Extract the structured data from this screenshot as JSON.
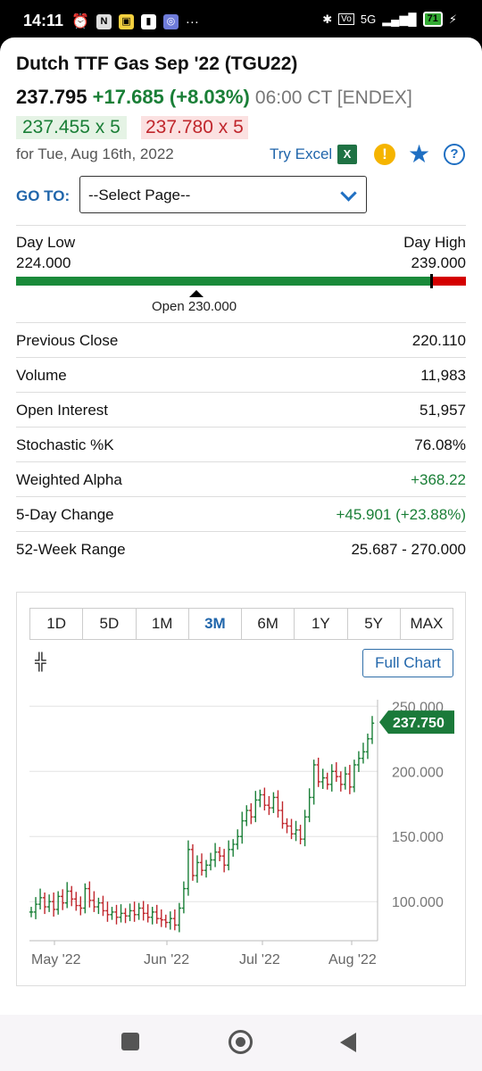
{
  "status_bar": {
    "time": "14:11",
    "battery": "71",
    "network": "5G"
  },
  "header": {
    "title": "Dutch TTF Gas Sep '22 (TGU22)",
    "last": "237.795",
    "change": "+17.685 (+8.03%)",
    "time": "06:00 CT [ENDEX]",
    "bid": "237.455 x 5",
    "ask": "237.780 x 5",
    "date": "for Tue, Aug 16th, 2022",
    "try_excel": "Try Excel"
  },
  "goto": {
    "label": "GO TO:",
    "select_value": "--Select Page--"
  },
  "day_range": {
    "low_label": "Day Low",
    "low": "224.000",
    "high_label": "Day High",
    "high": "239.000",
    "open_label": "Open 230.000"
  },
  "stats": [
    {
      "label": "Previous Close",
      "value": "220.110"
    },
    {
      "label": "Volume",
      "value": "11,983"
    },
    {
      "label": "Open Interest",
      "value": "51,957"
    },
    {
      "label": "Stochastic %K",
      "value": "76.08%"
    },
    {
      "label": "Weighted Alpha",
      "value": "+368.22"
    },
    {
      "label": "5-Day Change",
      "value": "+45.901 (+23.88%)"
    },
    {
      "label": "52-Week Range",
      "value": "25.687 - 270.000"
    }
  ],
  "chart": {
    "tabs": [
      "1D",
      "5D",
      "1M",
      "3M",
      "6M",
      "1Y",
      "5Y",
      "MAX"
    ],
    "active_tab": "3M",
    "full_chart": "Full Chart",
    "last_price_label": "237.750"
  },
  "chart_data": {
    "type": "ohlc",
    "x_ticks": [
      "May '22",
      "Jun '22",
      "Jul '22",
      "Aug '22"
    ],
    "y_ticks": [
      "250.000",
      "200.000",
      "150.000",
      "100.000"
    ],
    "ylim": [
      70,
      255
    ],
    "closes": [
      92,
      98,
      103,
      96,
      100,
      94,
      104,
      99,
      108,
      102,
      97,
      95,
      110,
      101,
      96,
      99,
      93,
      90,
      92,
      88,
      91,
      89,
      93,
      90,
      95,
      91,
      88,
      92,
      87,
      86,
      84,
      87,
      82,
      95,
      110,
      140,
      120,
      130,
      124,
      128,
      132,
      138,
      135,
      128,
      140,
      144,
      150,
      162,
      170,
      165,
      178,
      182,
      174,
      172,
      180,
      170,
      160,
      158,
      152,
      155,
      148,
      165,
      180,
      205,
      192,
      195,
      190,
      200,
      196,
      190,
      198,
      188,
      205,
      210,
      215,
      225,
      237
    ]
  },
  "colors": {
    "up": "#1a7f37",
    "down": "#c0262c",
    "accent": "#2166ab"
  }
}
